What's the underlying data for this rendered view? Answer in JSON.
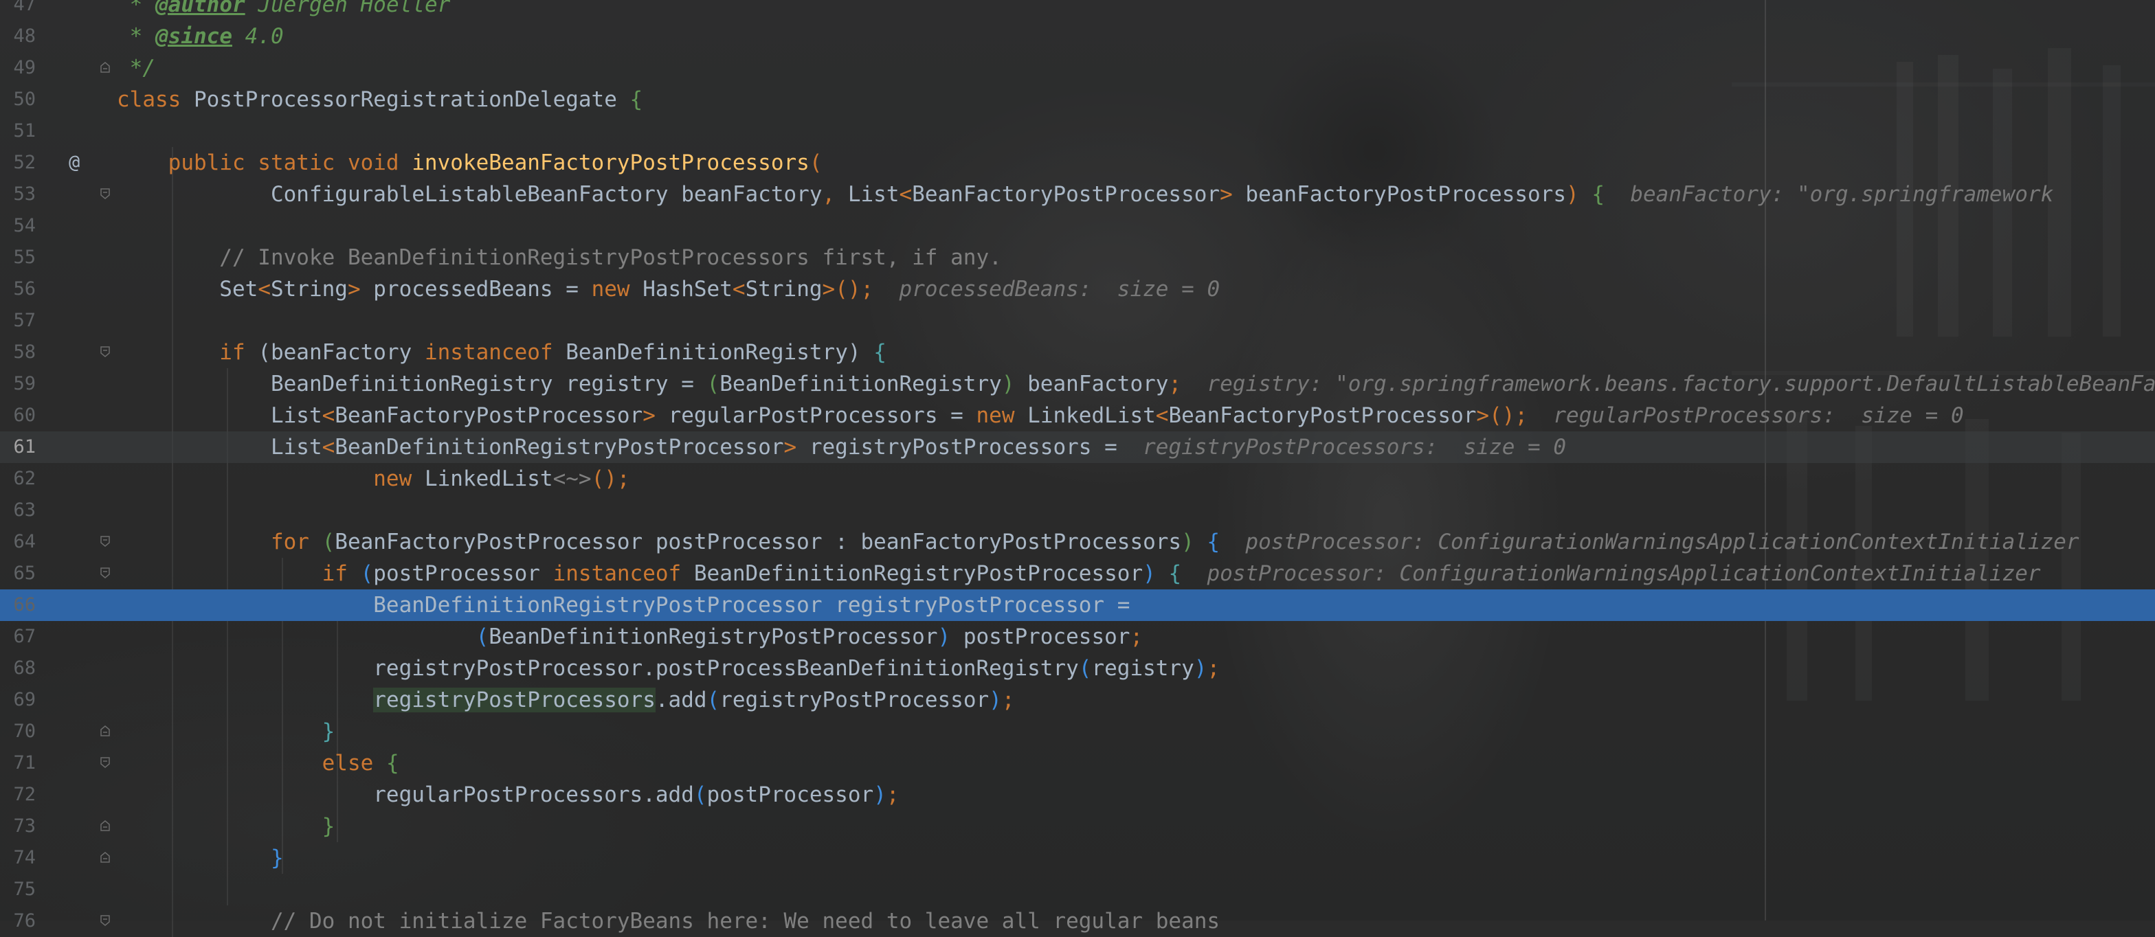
{
  "lines": [
    {
      "num": "47",
      "html": "<span class='dc'> * </span><span class='tg'>@author</span><span class='dc'> Juergen Hoeller</span>"
    },
    {
      "num": "48",
      "html": "<span class='dc'> * </span><span class='tg'>@since</span><span class='dc'> 4.0</span>"
    },
    {
      "num": "49",
      "html": "<span class='dc'> */</span>"
    },
    {
      "num": "50",
      "html": "<span class='kw'>class </span><span class='id'>PostProcessorRegistrationDelegate </span><span class='pa'>{</span>"
    },
    {
      "num": "51",
      "html": ""
    },
    {
      "num": "52",
      "html": "<span class='kw'>    public static void </span><span class='fn'>invokeBeanFactoryPostProcessors</span><span class='kw'>(</span>"
    },
    {
      "num": "53",
      "html": "<span class='id'>            ConfigurableListableBeanFactory beanFactory</span><span class='sep'>, </span><span class='id'>List</span><span class='kw'>&lt;</span><span class='id'>BeanFactoryPostProcessor</span><span class='kw'>&gt; </span><span class='id'>beanFactoryPostProcessors</span><span class='kw'>) </span><span class='pa'>{</span><span class='hint'>  beanFactory: \"org.springframework</span>"
    },
    {
      "num": "54",
      "html": ""
    },
    {
      "num": "55",
      "html": "<span class='cm'>        // Invoke BeanDefinitionRegistryPostProcessors first, if any.</span>"
    },
    {
      "num": "56",
      "html": "<span class='id'>        Set</span><span class='kw'>&lt;</span><span class='id'>String</span><span class='kw'>&gt; </span><span class='id'>processedBeans = </span><span class='kw'>new </span><span class='id'>HashSet</span><span class='kw'>&lt;</span><span class='id'>String</span><span class='kw'>&gt;();</span><span class='hint'>  processedBeans:  size = 0</span>"
    },
    {
      "num": "57",
      "html": ""
    },
    {
      "num": "58",
      "html": "<span class='kw'>        if </span><span class='id'>(beanFactory </span><span class='kw'>instanceof </span><span class='id'>BeanDefinitionRegistry) </span><span class='ps'>{</span>"
    },
    {
      "num": "59",
      "html": "<span class='id'>            BeanDefinitionRegistry registry = </span><span class='pa'>(</span><span class='id'>BeanDefinitionRegistry</span><span class='pa'>) </span><span class='id'>beanFactory</span><span class='kw'>;</span><span class='hint'>  registry: \"org.springframework.beans.factory.support.DefaultListableBeanFactory</span>"
    },
    {
      "num": "60",
      "html": "<span class='id'>            List</span><span class='kw'>&lt;</span><span class='id'>BeanFactoryPostProcessor</span><span class='kw'>&gt; </span><span class='id'>regularPostProcessors = </span><span class='kw'>new </span><span class='id'>LinkedList</span><span class='kw'>&lt;</span><span class='id'>BeanFactoryPostProcessor</span><span class='kw'>&gt;();</span><span class='hint'>  regularPostProcessors:  size = 0</span>"
    },
    {
      "num": "61",
      "html": "<span class='id'>            List</span><span class='kw'>&lt;</span><span class='id'>BeanDefinitionRegistryPostProcessor</span><span class='kw'>&gt; </span><span class='id'>registryPostProcessors = </span><span class='hint'> registryPostProcessors:  size = 0</span>"
    },
    {
      "num": "62",
      "html": "<span class='kw'>                    new </span><span class='id'>LinkedList</span><span class='fold-glyph'>&lt;~&gt;</span><span class='kw'>();</span>"
    },
    {
      "num": "63",
      "html": ""
    },
    {
      "num": "64",
      "html": "<span class='kw'>            for </span><span class='pa'>(</span><span class='id'>BeanFactoryPostProcessor postProcessor : beanFactoryPostProcessors</span><span class='pa'>) </span><span class='pb'>{</span><span class='hint'>  postProcessor: ConfigurationWarningsApplicationContextInitializer</span>"
    },
    {
      "num": "65",
      "html": "<span class='kw'>                if </span><span class='pb'>(</span><span class='id'>postProcessor </span><span class='kw'>instanceof </span><span class='id'>BeanDefinitionRegistryPostProcessor</span><span class='pb'>) </span><span class='ps'>{</span><span class='hint'>  postProcessor: ConfigurationWarningsApplicationContextInitializer</span>"
    },
    {
      "num": "66",
      "html": "<span class='id'>                    BeanDefinitionRegistryPostProcessor registryPostProcessor =</span>"
    },
    {
      "num": "67",
      "html": "<span class='id'>                            </span><span class='pb'>(</span><span class='id'>BeanDefinitionRegistryPostProcessor</span><span class='pb'>) </span><span class='id'>postProcessor</span><span class='kw'>;</span>"
    },
    {
      "num": "68",
      "html": "<span class='id'>                    registryPostProcessor.postProcessBeanDefinitionRegistry</span><span class='pb'>(</span><span class='id'>registry</span><span class='pb'>)</span><span class='kw'>;</span>"
    },
    {
      "num": "69",
      "html": "<span class='id'>                    </span><span class='id hl'>registryPostProcessors</span><span class='id'>.add</span><span class='pb'>(</span><span class='id'>registryPostProcessor</span><span class='pb'>)</span><span class='kw'>;</span>"
    },
    {
      "num": "70",
      "html": "<span class='ps'>                }</span>"
    },
    {
      "num": "71",
      "html": "<span class='kw'>                else </span><span class='pa'>{</span>"
    },
    {
      "num": "72",
      "html": "<span class='id'>                    regularPostProcessors.add</span><span class='pb'>(</span><span class='id'>postProcessor</span><span class='pb'>)</span><span class='kw'>;</span>"
    },
    {
      "num": "73",
      "html": "<span class='pa'>                }</span>"
    },
    {
      "num": "74",
      "html": "<span class='pb'>            }</span>"
    },
    {
      "num": "75",
      "html": ""
    },
    {
      "num": "76",
      "html": "<span class='cm'>            // Do not initialize FactoryBeans here: We need to leave all regular beans</span>"
    }
  ],
  "current_line": "61",
  "selected_line": "66",
  "gutter_marks": {
    "52": "@"
  },
  "folds": {
    "49": "end",
    "53": "start",
    "58": "start",
    "64": "start",
    "65": "start",
    "70": "end",
    "71": "start",
    "73": "end",
    "74": "end",
    "76": "start"
  },
  "colors": {
    "background": "#2b2b2b",
    "keyword": "#cc7832",
    "identifier": "#a9b7c6",
    "method_decl": "#ffc66d",
    "comment": "#808080",
    "doc": "#629755",
    "hint": "#787878",
    "selection": "#2f65a6"
  },
  "icons": {
    "fold": "fold-icon",
    "override": "override-marker-icon"
  }
}
